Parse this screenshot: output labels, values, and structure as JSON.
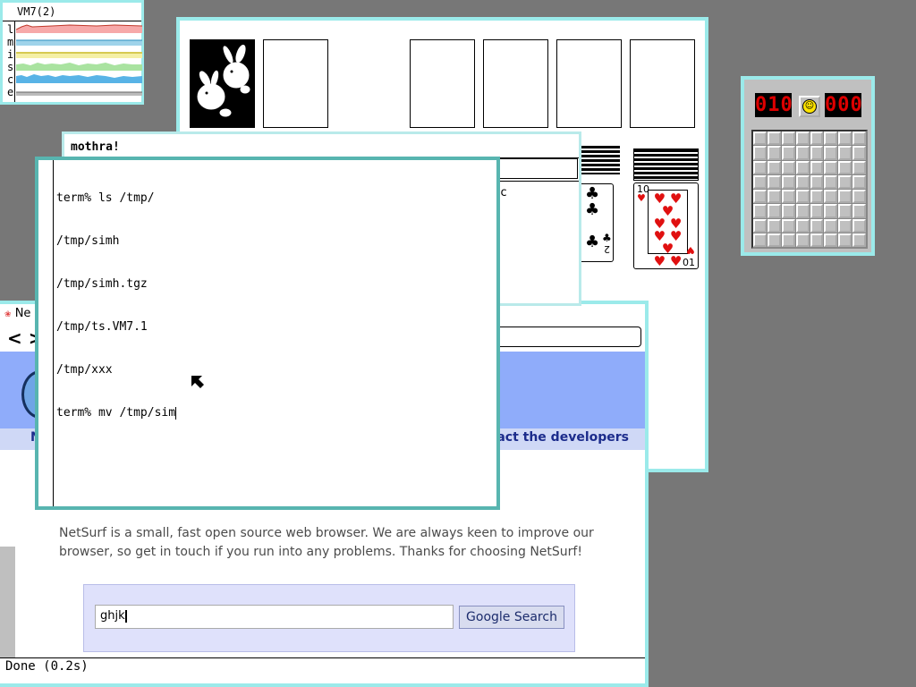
{
  "stats": {
    "title": "VM7(2)",
    "labels": [
      "l",
      "m",
      "i",
      "s",
      "c",
      "e"
    ]
  },
  "minesweeper": {
    "mine_counter": "010",
    "timer": "000",
    "face": "☺"
  },
  "solitaire": {
    "clubs_card": {
      "rank": "2",
      "suit": "♣"
    },
    "hearts_card": {
      "rank": "10",
      "rank_inverted": "01",
      "suit": "♥"
    }
  },
  "netsurf": {
    "title": "Ne",
    "back": "<",
    "forward": ">",
    "nav_link_fragment": "N",
    "contact_link": "ontact the developers",
    "body_text": "NetSurf is a small, fast open source web browser. We are always keen to improve our browser, so get in touch if you run into any problems. Thanks for choosing NetSurf!",
    "search_value": "ghjk",
    "search_button": "Google Search",
    "status": "Done (0.2s)"
  },
  "mothra": {
    "title": "mothra!",
    "fragment": "c"
  },
  "terminal": {
    "lines": [
      "term% ls /tmp/",
      "/tmp/simh",
      "/tmp/simh.tgz",
      "/tmp/ts.VM7.1",
      "/tmp/xxx"
    ],
    "prompt_line": "term% mv /tmp/sim"
  },
  "colors": {
    "desktop": "#777777",
    "window_border": "#9beaea",
    "active_border": "#58b5b0",
    "netsurf_banner": "#8facfa",
    "link": "#1c2c8c",
    "heart": "#e01010"
  }
}
